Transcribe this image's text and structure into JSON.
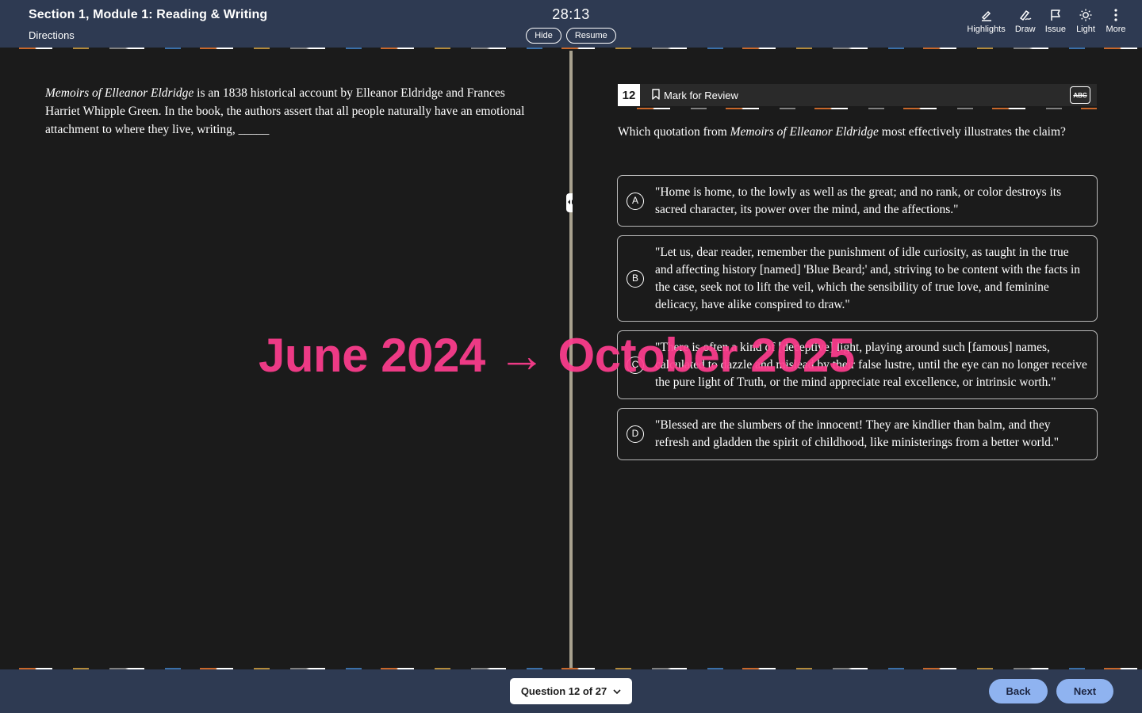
{
  "header": {
    "section_title": "Section 1, Module 1: Reading & Writing",
    "directions_label": "Directions",
    "timer": "28:13",
    "hide_label": "Hide",
    "resume_label": "Resume",
    "tools": [
      {
        "label": "Highlights",
        "icon": "highlight-pen-icon"
      },
      {
        "label": "Draw",
        "icon": "pencil-draw-icon"
      },
      {
        "label": "Issue",
        "icon": "flag-icon"
      },
      {
        "label": "Light",
        "icon": "sun-icon"
      },
      {
        "label": "More",
        "icon": "vertical-ellipsis-icon"
      }
    ]
  },
  "passage": {
    "title_italic": "Memoirs of Elleanor Eldridge",
    "text": " is an 1838 historical account by Elleanor Eldridge and Frances Harriet Whipple Green. In the book, the authors assert that all people naturally have an emotional attachment to where they live, writing, _____"
  },
  "question": {
    "number": "12",
    "mark_label": "Mark for Review",
    "abc_label": "ABC",
    "prompt_before": "Which quotation from ",
    "prompt_italic": "Memoirs of Elleanor Eldridge",
    "prompt_after": " most effectively illustrates the claim?",
    "choices": [
      {
        "letter": "A",
        "text": "\"Home is home, to the lowly as well as the great; and no rank, or color destroys its sacred character, its power over the mind, and the affections.\""
      },
      {
        "letter": "B",
        "text": "\"Let us, dear reader, remember the punishment of idle curiosity, as taught in the true and affecting history [named] 'Blue Beard;' and, striving to be content with the facts in the case, seek not to lift the veil, which the sensibility of true love, and feminine delicacy, have alike conspired to draw.\""
      },
      {
        "letter": "C",
        "text": "\"There is often a kind of [deceptive] light, playing around such [famous] names, calculated to dazzle and mislead by their false lustre, until the eye can no longer receive the pure light of Truth, or the mind appreciate real excellence, or intrinsic worth.\""
      },
      {
        "letter": "D",
        "text": "\"Blessed are the slumbers of the innocent! They are kindlier than balm, and they refresh and gladden the spirit of childhood, like ministerings from a better world.\""
      }
    ]
  },
  "footer": {
    "question_nav_label": "Question 12 of 27",
    "back_label": "Back",
    "next_label": "Next"
  },
  "overlay": {
    "text": "June 2024 → October 2025"
  },
  "colors": {
    "header_bg": "#2e3a52",
    "body_bg": "#1b1b1b",
    "nav_button": "#8fb3f0",
    "overlay": "#ff3d8e"
  }
}
